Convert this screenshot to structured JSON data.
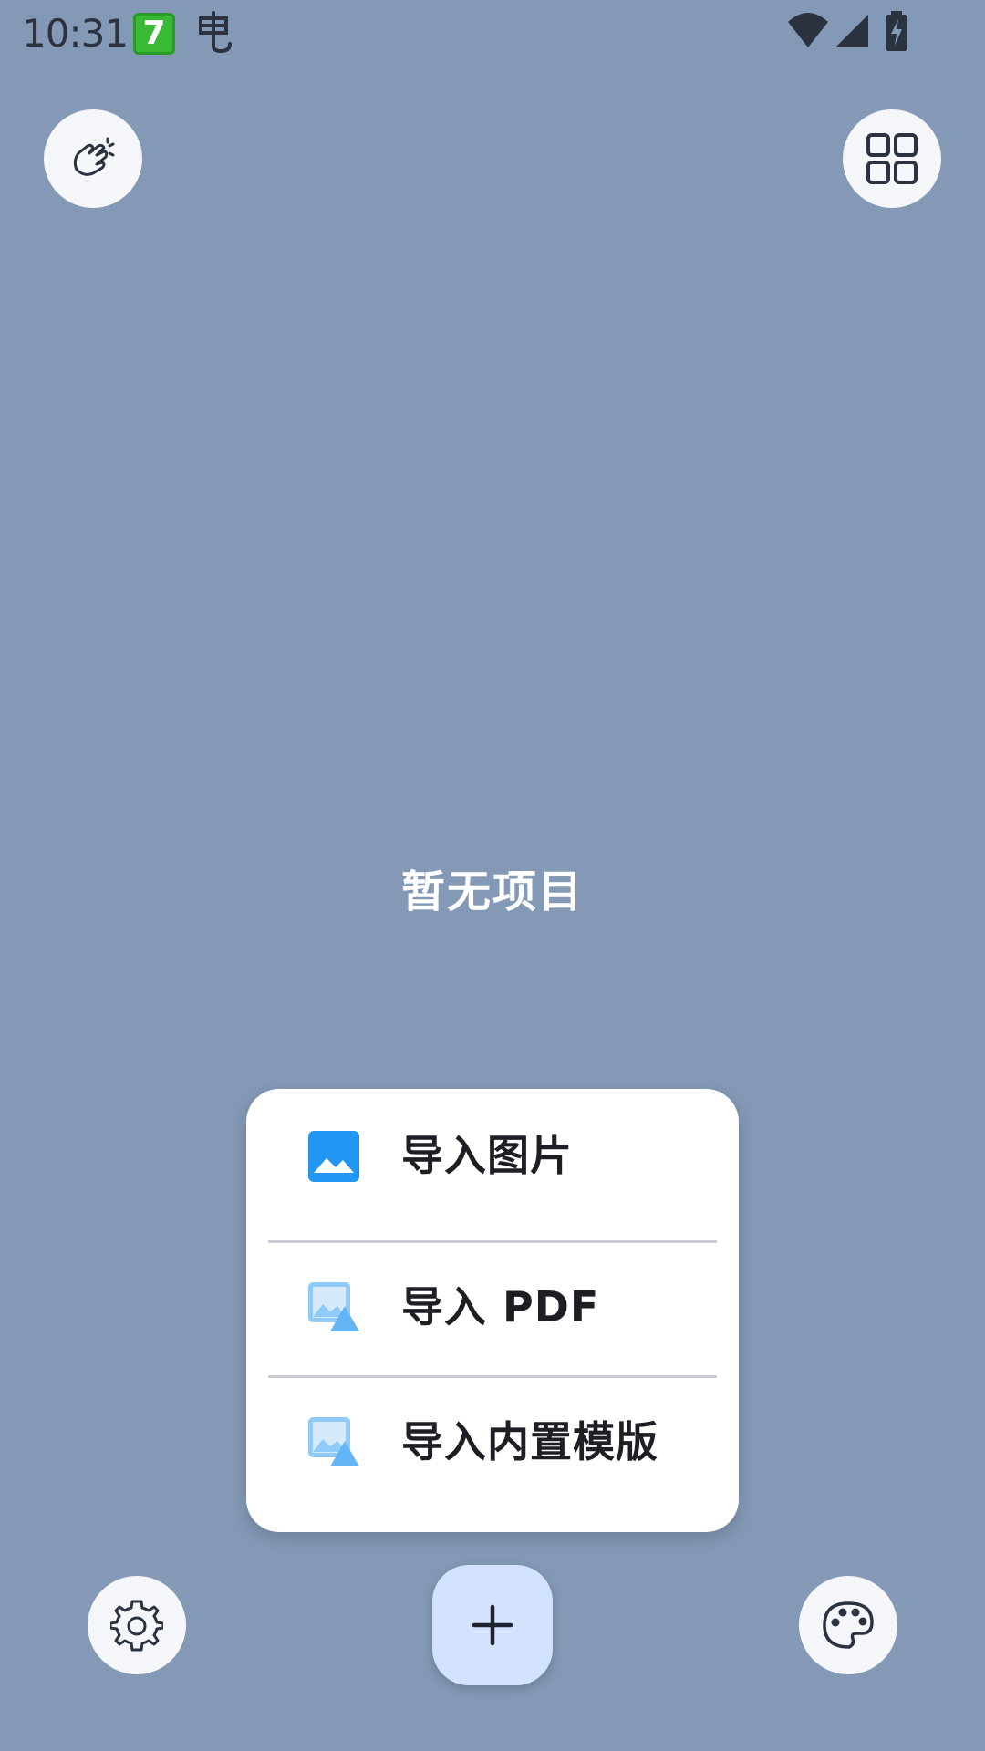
{
  "status_bar": {
    "time": "10:31",
    "app_icon_1": "7",
    "app_icon_2_name": "bug-app-icon",
    "wifi": "wifi-icon",
    "signal": "signal-icon",
    "battery": "battery-charging-icon"
  },
  "toolbar": {
    "top_left_icon": "hand-sparkle-icon",
    "top_right_icon": "grid-view-icon"
  },
  "main": {
    "empty_text": "暂无项目"
  },
  "menu": {
    "items": [
      {
        "label": "导入图片",
        "icon": "image-icon"
      },
      {
        "label": "导入 PDF",
        "icon": "image-pdf-icon"
      },
      {
        "label": "导入内置模版",
        "icon": "image-template-icon"
      }
    ]
  },
  "bottom_bar": {
    "settings_icon": "gear-icon",
    "fab_icon": "plus-icon",
    "palette_icon": "palette-icon"
  },
  "colors": {
    "background": "#8499b6",
    "menu_bg": "#ffffff",
    "fab_bg": "#d3e3fd",
    "accent_blue": "#2196f3",
    "faded_blue": "#90caf9"
  }
}
